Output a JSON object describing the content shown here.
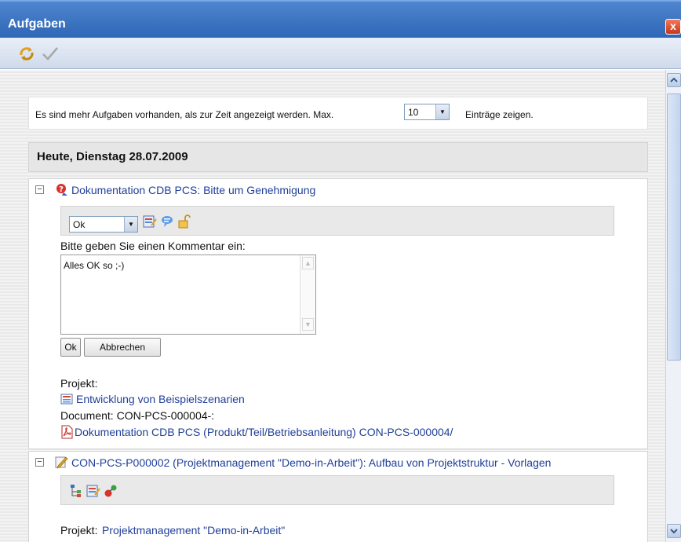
{
  "window": {
    "title": "Aufgaben",
    "close_label": "x"
  },
  "toolbar": {
    "icons": [
      "refresh-icon",
      "check-icon"
    ]
  },
  "info": {
    "text_before": "Es sind mehr Aufgaben vorhanden, als zur Zeit angezeigt werden. Max.",
    "max_value": "10",
    "text_after": "Einträge zeigen."
  },
  "day": {
    "heading": "Heute, Dienstag 28.07.2009"
  },
  "tasks": [
    {
      "title": "Dokumentation CDB PCS: Bitte um Genehmigung",
      "decision_value": "Ok",
      "comment_prompt": "Bitte geben Sie einen Kommentar ein:",
      "comment_text": "Alles OK so ;-)",
      "ok_label": "Ok",
      "cancel_label": "Abbrechen",
      "project_label": "Projekt:",
      "project_name": "Entwicklung von Beispielszenarien",
      "document_label": "Document: CON-PCS-000004-:",
      "document_name": "Dokumentation CDB PCS (Produkt/Teil/Betriebsanleitung) CON-PCS-000004/"
    },
    {
      "title": "CON-PCS-P000002 (Projektmanagement \"Demo-in-Arbeit\"): Aufbau von Projektstruktur - Vorlagen",
      "project_label": "Projekt:",
      "project_name": "Projektmanagement \"Demo-in-Arbeit\""
    }
  ],
  "colors": {
    "titlebar": "#2f66b6",
    "link": "#1f3f99"
  }
}
